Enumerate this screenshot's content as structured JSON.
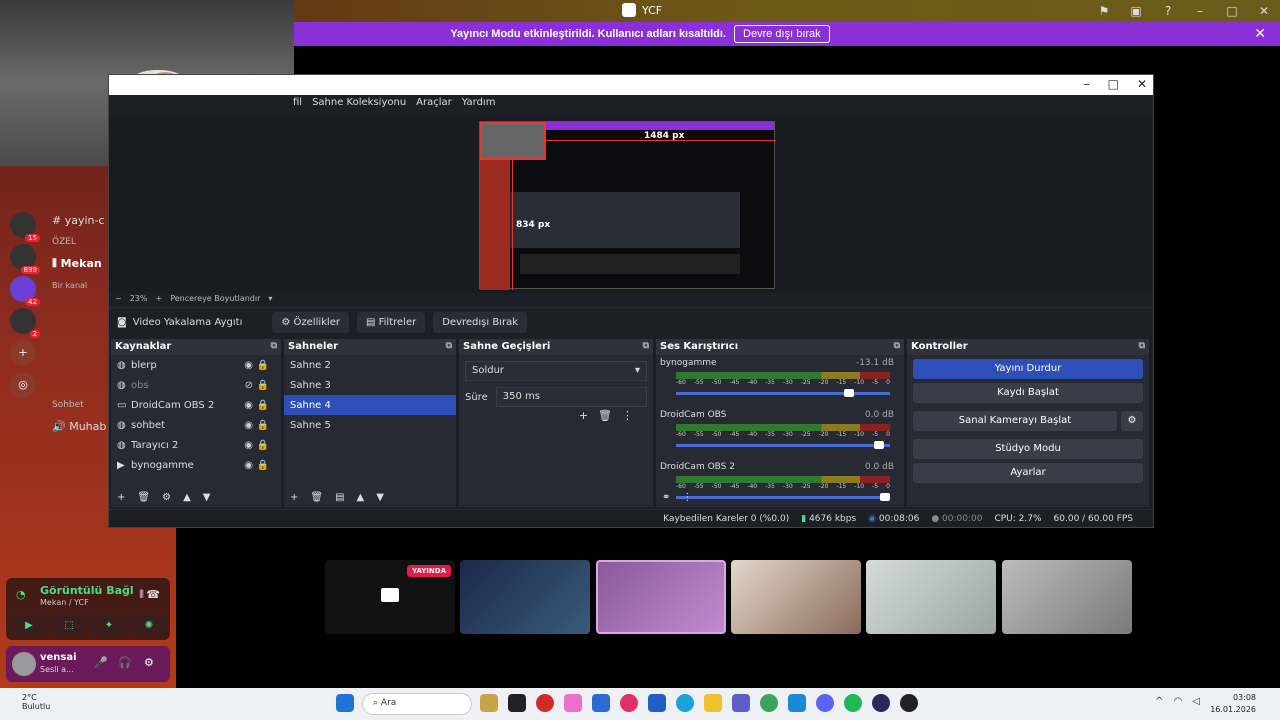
{
  "discord": {
    "window_title": "YCF",
    "streamer_notice": "Yayıncı Modu etkinleştirildi. Kullanıcı adları kısaltıldı.",
    "streamer_disable": "Devre dışı bırak",
    "channels": [
      "yayin-c",
      "ÖZEL",
      "Mekan",
      "Bir kanal",
      "Sohbet",
      "Muhab"
    ],
    "server_badges": [
      "15",
      "899",
      "42",
      "2"
    ],
    "voice": {
      "title": "Görüntülü Bağl",
      "subtitle": "Mekan / YCF"
    },
    "user": {
      "name": "vensai",
      "status": "Sesli a..."
    }
  },
  "obs": {
    "menu": [
      "fil",
      "Sahne Koleksiyonu",
      "Araçlar",
      "Yardım"
    ],
    "preview": {
      "width_label": "1484 px",
      "height_label": "834 px"
    },
    "zoom": {
      "minus": "−",
      "value": "23%",
      "plus": "+",
      "fit": "Pencereye Boyutlandır"
    },
    "source_bar": {
      "name": "Video Yakalama Aygıtı",
      "properties": "Özellikler",
      "filters": "Filtreler",
      "deactivate": "Devredışı Bırak"
    },
    "sources": {
      "title": "Kaynaklar",
      "items": [
        {
          "label": "blerp"
        },
        {
          "label": "obs"
        },
        {
          "label": "DroidCam OBS 2"
        },
        {
          "label": "sohbet"
        },
        {
          "label": "Tarayıcı 2"
        },
        {
          "label": "bynogamme"
        }
      ]
    },
    "scenes": {
      "title": "Sahneler",
      "items": [
        "Sahne 2",
        "Sahne 3",
        "Sahne 4",
        "Sahne 5"
      ],
      "selected": "Sahne 4"
    },
    "transitions": {
      "title": "Sahne Geçişleri",
      "type": "Soldur",
      "duration_label": "Süre",
      "duration": "350 ms"
    },
    "mixer": {
      "title": "Ses Karıştırıcı",
      "scale": [
        "-60",
        "-55",
        "-50",
        "-45",
        "-40",
        "-35",
        "-30",
        "-25",
        "-20",
        "-15",
        "-10",
        "-5",
        "0"
      ],
      "channels": [
        {
          "name": "bynogamme",
          "db": "-13.1 dB",
          "level": 0.83
        },
        {
          "name": "DroidCam OBS",
          "db": "0.0 dB",
          "level": 0.97
        },
        {
          "name": "DroidCam OBS 2",
          "db": "0.0 dB",
          "level": 1.0
        }
      ]
    },
    "controls": {
      "title": "Kontroller",
      "stop_stream": "Yayını Durdur",
      "start_record": "Kaydı Başlat",
      "virtual_cam": "Sanal Kamerayı Başlat",
      "studio": "Stüdyo Modu",
      "settings": "Ayarlar"
    },
    "status": {
      "dropped": "Kaybedilen Kareler 0 (%0.0)",
      "bitrate": "4676 kbps",
      "live_time": "00:08:06",
      "rec_time": "00:00:00",
      "cpu": "CPU: 2.7%",
      "fps": "60.00 / 60.00 FPS"
    }
  },
  "call": {
    "live_badge": "YAYINDA"
  },
  "taskbar": {
    "temp": "2°C",
    "weather": "Bulutlu",
    "search": "Ara",
    "time": "03:08",
    "date": "16.01.2026"
  },
  "colors": {
    "accent": "#2e4fb8",
    "streamer": "#8b2fd6",
    "live": "#e11d48"
  }
}
